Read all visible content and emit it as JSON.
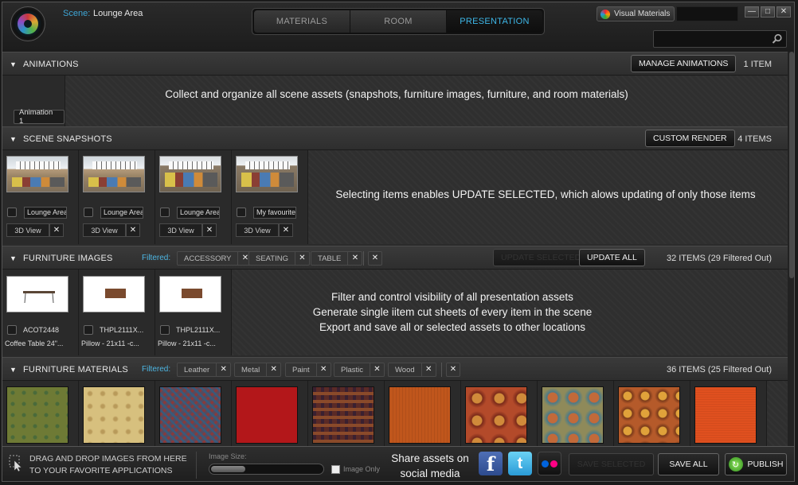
{
  "app": {
    "scene_label": "Scene:",
    "scene_name": "Lounge Area",
    "tabs": [
      {
        "label": "MATERIALS",
        "active": false
      },
      {
        "label": "ROOM",
        "active": false
      },
      {
        "label": "PRESENTATION",
        "active": true
      }
    ],
    "visual_materials_label": "Visual Materials",
    "search_placeholder": ""
  },
  "animations": {
    "title": "ANIMATIONS",
    "manage_button": "MANAGE ANIMATIONS",
    "count": "1 ITEM",
    "items": [
      "Animation 1"
    ],
    "hint": "Collect and organize all scene assets (snapshots, furniture images, furniture, and room materials)"
  },
  "snapshots": {
    "title": "SCENE SNAPSHOTS",
    "custom_render_button": "CUSTOM RENDER",
    "count": "4 ITEMS",
    "items": [
      {
        "name": "Lounge Area",
        "view": "3D View"
      },
      {
        "name": "Lounge Area",
        "view": "3D View"
      },
      {
        "name": "Lounge Area",
        "view": "3D View"
      },
      {
        "name": "My favourite",
        "view": "3D View"
      }
    ],
    "hint": "Selecting items enables UPDATE SELECTED, which alows updating of only those items"
  },
  "furniture_images": {
    "title": "FURNITURE IMAGES",
    "filtered_label": "Filtered:",
    "filters": [
      "ACCESSORY",
      "SEATING",
      "TABLE"
    ],
    "update_selected_button": "UPDATE SELECTED",
    "update_all_button": "UPDATE ALL",
    "count": "32 ITEMS (29 Filtered Out)",
    "items": [
      {
        "code": "ACOT2448",
        "desc": "Coffee Table 24\"..."
      },
      {
        "code": "THPL2111X...",
        "desc": "Pillow - 21x11 -c..."
      },
      {
        "code": "THPL2111X...",
        "desc": "Pillow - 21x11 -c..."
      }
    ],
    "hint_lines": [
      "Filter and control visibility of all presentation assets",
      "Generate single iitem cut sheets of every item in the scene",
      "Export and save all or selected assets to other locations"
    ]
  },
  "furniture_materials": {
    "title": "FURNITURE MATERIALS",
    "filtered_label": "Filtered:",
    "filters": [
      "Leather",
      "Metal",
      "Paint",
      "Plastic",
      "Wood"
    ],
    "count": "36 ITEMS (25 Filtered Out)",
    "swatch_colors": [
      "#6e7a35",
      "#d7c07e",
      "#5a4a5c",
      "#b3171a",
      "#5a2a26",
      "#c0561c",
      "#b34a2a",
      "#8f8a5a",
      "#b55a2a",
      "#e0501f"
    ]
  },
  "bottom": {
    "drag_line1": "DRAG AND DROP IMAGES FROM HERE",
    "drag_line2": "TO YOUR FAVORITE APPLICATIONS",
    "image_size_label": "Image Size:",
    "image_size_level": 0.3,
    "image_only_label": "Image Only",
    "share_line1": "Share assets on",
    "share_line2": "social media",
    "save_selected_button": "SAVE SELECTED",
    "save_all_button": "SAVE ALL",
    "publish_button": "PUBLISH"
  }
}
